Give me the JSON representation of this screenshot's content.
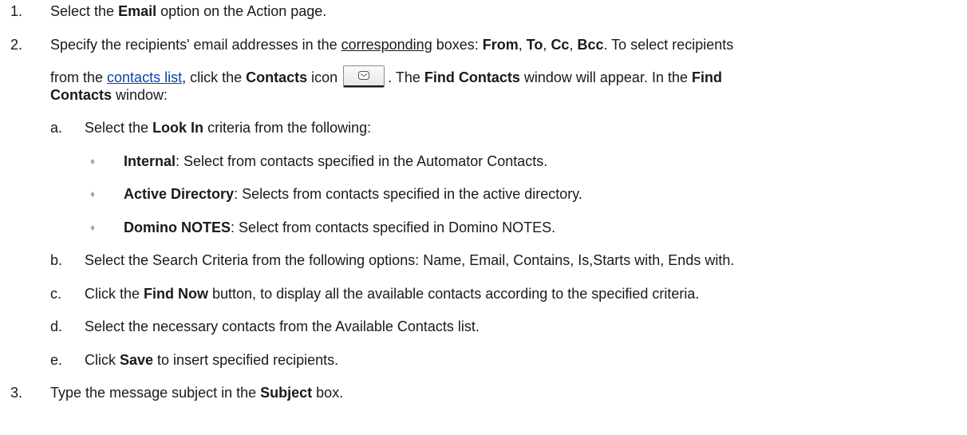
{
  "steps": [
    {
      "num": "1.",
      "parts": [
        "Select the ",
        "Email",
        " option on the Action page."
      ]
    },
    {
      "num": "2.",
      "line1": [
        "Specify the recipients' email addresses in the ",
        "corresponding",
        " boxes: ",
        "From",
        ", ",
        "To",
        ", ",
        "Cc",
        ", ",
        "Bcc",
        ". To select recipients"
      ],
      "line2": [
        "from the ",
        "contacts list",
        ", click the ",
        "Contacts",
        " icon ",
        ". The ",
        "Find Contacts",
        " window will appear. In the ",
        "Find"
      ],
      "line3": [
        "Contacts",
        " window:"
      ]
    },
    {
      "num": "3.",
      "parts": [
        "Type the message subject in the ",
        "Subject",
        " box."
      ]
    }
  ],
  "substeps": [
    {
      "letter": "a.",
      "parts": [
        "Select the ",
        "Look In",
        " criteria from the following:"
      ]
    },
    {
      "letter": "b.",
      "parts": [
        "Select the Search Criteria from the following options: Name, Email, Contains, Is,Starts with, Ends with."
      ]
    },
    {
      "letter": "c.",
      "parts": [
        "Click the ",
        "Find Now",
        " button, to display all the available contacts according to the specified criteria."
      ]
    },
    {
      "letter": "d.",
      "parts": [
        "Select the necessary contacts from the Available Contacts list."
      ]
    },
    {
      "letter": "e.",
      "parts": [
        "Click ",
        "Save",
        " to insert specified recipients."
      ]
    }
  ],
  "bullets": [
    {
      "term": "Internal",
      "text": ":  Select from contacts specified in the Automator Contacts."
    },
    {
      "term": "Active Directory",
      "text": ": Selects from contacts specified in the active directory."
    },
    {
      "term": "Domino NOTES",
      "text": ": Select from contacts specified in Domino NOTES."
    }
  ],
  "icons": {
    "contacts": "envelope-icon"
  },
  "colors": {
    "link": "#0645ad",
    "bullet": "#9aa7b8",
    "text": "#1a1a1a"
  }
}
